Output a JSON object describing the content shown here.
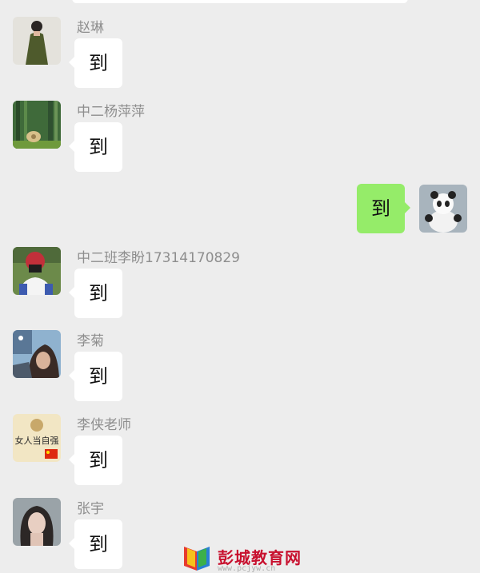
{
  "messages": [
    {
      "sender": "赵琳",
      "text": "到",
      "avatar_icon": "woman-green-dress-avatar"
    },
    {
      "sender": "中二杨萍萍",
      "text": "到",
      "avatar_icon": "forest-scene-avatar"
    },
    {
      "sender": "",
      "text": "到",
      "avatar_icon": "panda-avatar",
      "outgoing": true
    },
    {
      "sender": "中二班李盼17314170829",
      "text": "到",
      "avatar_icon": "camera-person-avatar"
    },
    {
      "sender": "李菊",
      "text": "到",
      "avatar_icon": "girl-photo-avatar"
    },
    {
      "sender": "李侠老师",
      "text": "到",
      "avatar_icon": "poster-flag-avatar",
      "avatar_text": "女人当自强"
    },
    {
      "sender": "张宇",
      "text": "到",
      "avatar_icon": "woman-portrait-avatar"
    }
  ],
  "watermark": {
    "name": "彭城教育网",
    "url": "www.pcjyw.cn",
    "icon": "book-logo-icon"
  },
  "colors": {
    "background": "#ededed",
    "incoming_bubble": "#ffffff",
    "outgoing_bubble": "#95ec69",
    "sender_text": "#8e8e8e"
  }
}
